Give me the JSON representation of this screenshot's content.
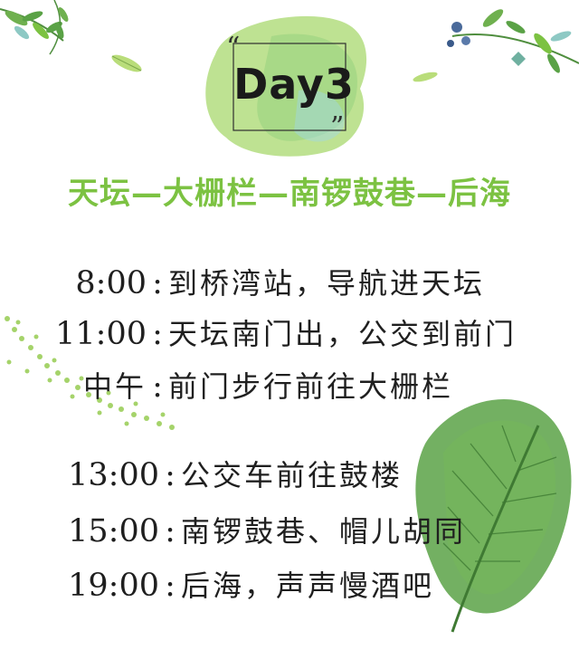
{
  "badge": {
    "label": "Day3"
  },
  "title": "天坛—大栅栏—南锣鼓巷—后海",
  "schedule": [
    {
      "time": "8:00",
      "activity": "到桥湾站，导航进天坛"
    },
    {
      "time": "11:00",
      "activity": "天坛南门出，公交到前门"
    },
    {
      "time": "中午",
      "activity": "前门步行前往大栅栏"
    },
    {
      "time": "13:00",
      "activity": "公交车前往鼓楼"
    },
    {
      "time": "15:00",
      "activity": "南锣鼓巷、帽儿胡同"
    },
    {
      "time": "19:00",
      "activity": "后海，声声慢酒吧"
    }
  ],
  "colors": {
    "title": "#7cc242",
    "leaf": "#5aa246",
    "splash": "#a8d86e"
  }
}
